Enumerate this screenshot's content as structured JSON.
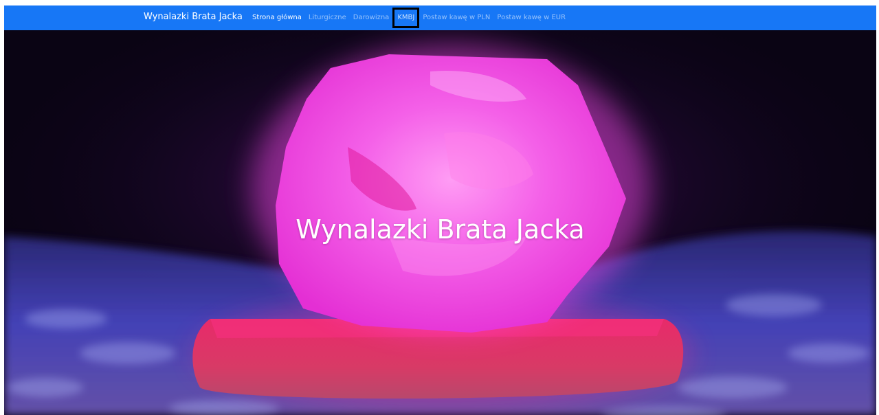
{
  "navbar": {
    "brand": "Wynalazki Brata Jacka",
    "background_color": "#1777f6",
    "links": [
      {
        "label": "Strona główna",
        "state": "active"
      },
      {
        "label": "Liturgiczne",
        "state": "normal"
      },
      {
        "label": "Darowizna",
        "state": "normal"
      },
      {
        "label": "KMBJ",
        "state": "focused"
      },
      {
        "label": "Postaw kawę w PLN",
        "state": "normal"
      },
      {
        "label": "Postaw kawę w EUR",
        "state": "normal"
      }
    ]
  },
  "hero": {
    "title": "Wynalazki Brata Jacka",
    "image": "glowing-pink-salt-lamp-image"
  }
}
